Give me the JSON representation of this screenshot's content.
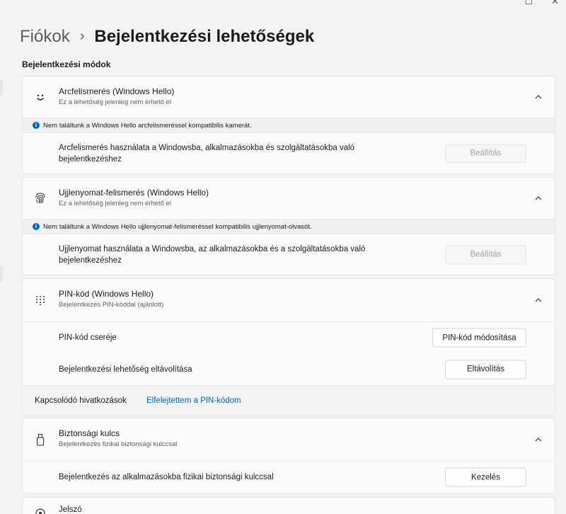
{
  "breadcrumb": {
    "parent": "Fiókok",
    "separator": "›",
    "title": "Bejelentkezési lehetőségek"
  },
  "section_label": "Bejelentkezési módok",
  "face": {
    "title": "Arcfelismerés (Windows Hello)",
    "subtitle": "Ez a lehetőség jelenleg nem érhető el",
    "info": "Nem találtunk a Windows Hello arcfelismeréssel kompatibilis kamerát.",
    "setting_label": "Arcfelismerés használata a Windowsba, alkalmazásokba és szolgáltatásokba való bejelentkezéshez",
    "button": "Beállítás"
  },
  "fingerprint": {
    "title": "Ujjlenyomat-felismerés (Windows Hello)",
    "subtitle": "Ez a lehetőség jelenleg nem érhető el",
    "info": "Nem találtunk a Windows Hello ujjlenyomat-felismeréssel kompatibilis ujjlenyomat-olvasót.",
    "setting_label": "Ujjlenyomat használata a Windowsba, az alkalmazásokba és a szolgáltatásokba való bejelentkezéshez",
    "button": "Beállítás"
  },
  "pin": {
    "title": "PIN-kód (Windows Hello)",
    "subtitle": "Bejelentkezés PIN-kóddal (ajánlott)",
    "change_label": "PIN-kód cseréje",
    "change_button": "PIN-kód módosítása",
    "remove_label": "Bejelentkezési lehetőség eltávolítása",
    "remove_button": "Eltávolítás",
    "related_label": "Kapcsolódó hivatkozások",
    "forgot_link": "Elfelejtettem a PIN-kódom"
  },
  "security_key": {
    "title": "Biztonsági kulcs",
    "subtitle": "Bejelentkezés fizikai biztonsági kulccsal",
    "setting_label": "Bejelentkezés az alkalmazásokba fizikai biztonsági kulccsal",
    "button": "Kezelés"
  },
  "password": {
    "title": "Jelszó"
  },
  "icons": {
    "face": "smiley-face-icon",
    "fingerprint": "fingerprint-icon",
    "pin": "pin-keypad-icon",
    "security_key": "usb-key-icon",
    "password": "key-icon",
    "info": "info-icon",
    "chevron": "chevron-up-icon"
  },
  "colors": {
    "accent": "#0067c0",
    "background": "#f3f3f3",
    "card": "#fbfbfb"
  }
}
